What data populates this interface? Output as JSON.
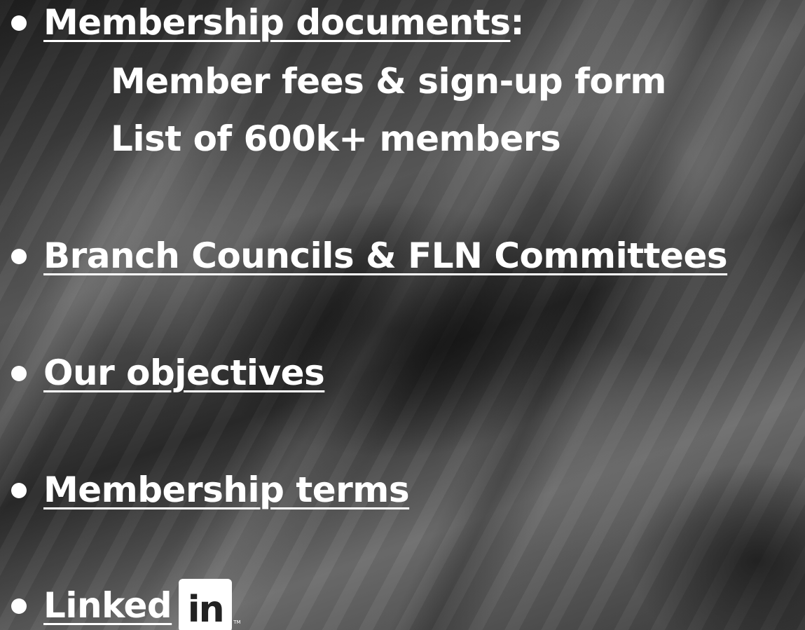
{
  "items": [
    {
      "label": "Membership documents",
      "suffix": ":",
      "sub_items": [
        "Member fees & sign-up form",
        "List of 600k+ members"
      ]
    },
    {
      "label": "Branch Councils & FLN Committees"
    },
    {
      "label": "Our objectives"
    },
    {
      "label": "Membership terms"
    },
    {
      "label": "Linked",
      "logo_text": "in",
      "trademark": "TM"
    }
  ],
  "colors": {
    "text": "#ffffff",
    "background": "#2e2e2e"
  }
}
